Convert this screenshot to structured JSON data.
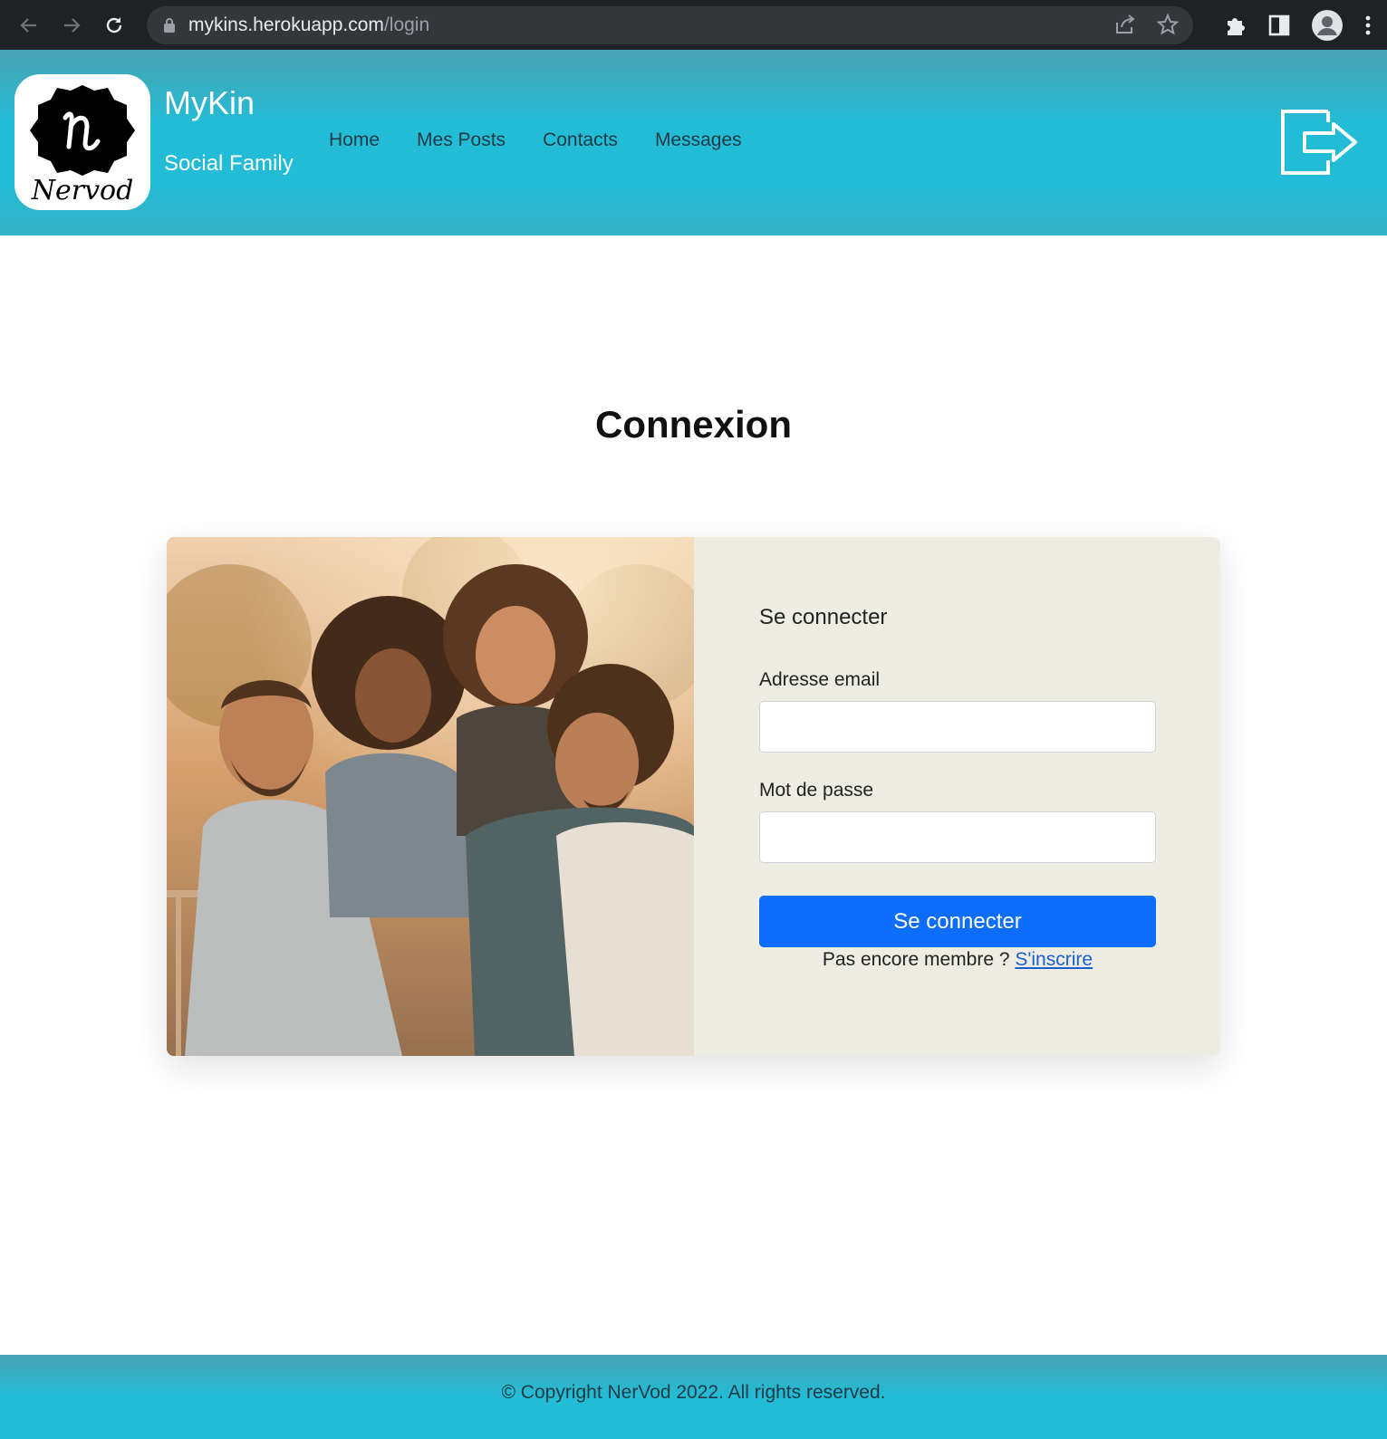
{
  "browser": {
    "url_host": "mykins.herokuapp.com",
    "url_path": "/login",
    "back_icon": "arrow-left-icon",
    "forward_icon": "arrow-right-icon",
    "reload_icon": "reload-icon",
    "lock_icon": "lock-icon",
    "share_icon": "share-icon",
    "star_icon": "star-icon",
    "extensions_icon": "puzzle-icon",
    "sidepanel_icon": "side-panel-icon",
    "profile_icon": "avatar-icon",
    "menu_icon": "kebab-menu-icon"
  },
  "header": {
    "logo_text": "Nervod",
    "logo_monogram": "n",
    "title": "MyKin",
    "subtitle": "Social Family",
    "nav": [
      {
        "label": "Home"
      },
      {
        "label": "Mes Posts"
      },
      {
        "label": "Contacts"
      },
      {
        "label": "Messages"
      }
    ],
    "logout_icon": "logout-icon"
  },
  "main": {
    "title": "Connexion",
    "form": {
      "heading": "Se connecter",
      "email_label": "Adresse email",
      "email_value": "",
      "password_label": "Mot de passe",
      "password_value": "",
      "submit_label": "Se connecter",
      "signup_prompt": "Pas encore membre ? ",
      "signup_link": "S'inscrire"
    }
  },
  "footer": {
    "text": "© Copyright NerVod 2022. All rights reserved."
  },
  "colors": {
    "header_accent": "#22bcd6",
    "button_primary": "#0d6efd",
    "card_bg": "#eeede4",
    "link": "#1a5fd0"
  }
}
